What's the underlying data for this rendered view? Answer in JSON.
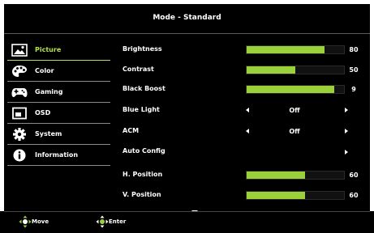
{
  "header": {
    "title": "Mode - Standard"
  },
  "sidebar": {
    "items": [
      {
        "label": "Picture",
        "icon": "picture-icon",
        "active": true
      },
      {
        "label": "Color",
        "icon": "palette-icon",
        "active": false
      },
      {
        "label": "Gaming",
        "icon": "gamepad-icon",
        "active": false
      },
      {
        "label": "OSD",
        "icon": "osd-window-icon",
        "active": false
      },
      {
        "label": "System",
        "icon": "gear-icon",
        "active": false
      },
      {
        "label": "Information",
        "icon": "info-icon",
        "active": false
      }
    ]
  },
  "settings": {
    "brightness": {
      "label": "Brightness",
      "value": "80",
      "level": 80
    },
    "contrast": {
      "label": "Contrast",
      "value": "50",
      "level": 50
    },
    "black_boost": {
      "label": "Black Boost",
      "value": "9",
      "level": 90
    },
    "blue_light": {
      "label": "Blue Light",
      "value": "Off"
    },
    "acm": {
      "label": "ACM",
      "value": "Off"
    },
    "auto_config": {
      "label": "Auto Config"
    },
    "h_position": {
      "label": "H. Position",
      "value": "60",
      "level": 60
    },
    "v_position": {
      "label": "V. Position",
      "value": "60",
      "level": 60
    }
  },
  "footer": {
    "move_label": "Move",
    "enter_label": "Enter"
  },
  "colors": {
    "accent": "#9ad13a",
    "active_text": "#b8e04a",
    "background": "#000000",
    "text": "#ffffff"
  }
}
